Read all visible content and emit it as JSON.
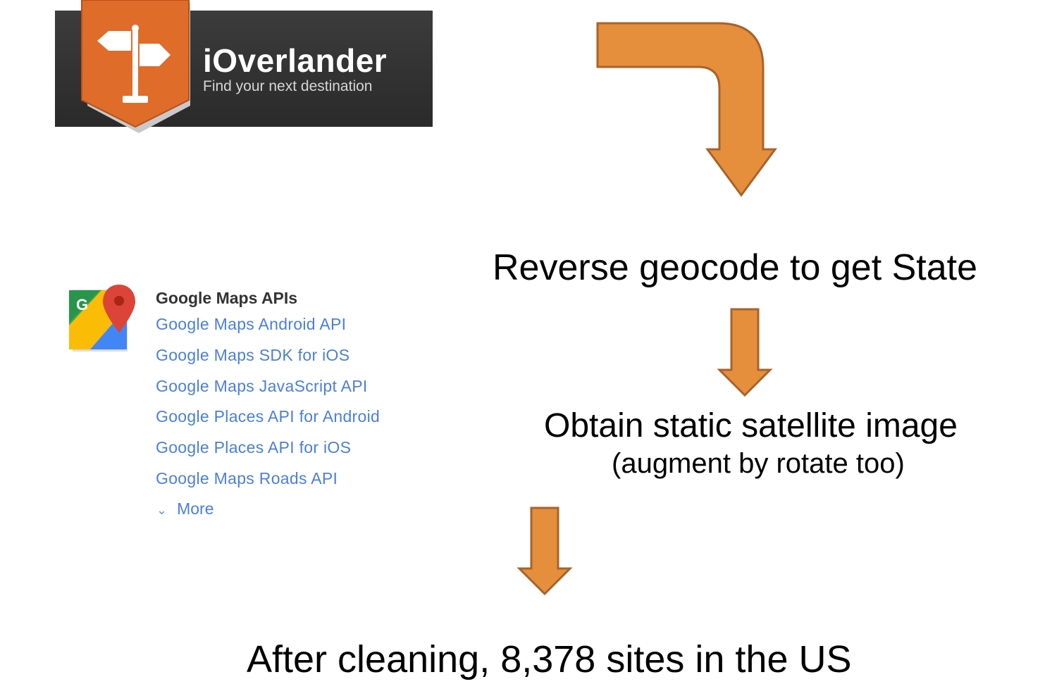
{
  "colors": {
    "arrow_fill": "#e58e3c",
    "arrow_stroke": "#a8632a",
    "banner_bg": "#2e2e2e",
    "shield_orange": "#e06c2a",
    "link_blue": "#4a7fe0"
  },
  "ioverlander": {
    "title": "iOverlander",
    "tagline": "Find your next destination",
    "icon": "signpost-icon"
  },
  "google_maps": {
    "icon": "google-maps-icon",
    "icon_letter": "G",
    "heading": "Google Maps APIs",
    "links": [
      "Google Maps Android API",
      "Google Maps SDK for iOS",
      "Google Maps JavaScript API",
      "Google Places API for Android",
      "Google Places API for iOS",
      "Google Maps Roads API"
    ],
    "more_label": "More"
  },
  "flow": {
    "step_geocode": "Reverse geocode to get State",
    "step_satellite": "Obtain static satellite image",
    "step_satellite_note": "(augment by rotate too)",
    "result": "After cleaning, 8,378 sites in the US"
  }
}
